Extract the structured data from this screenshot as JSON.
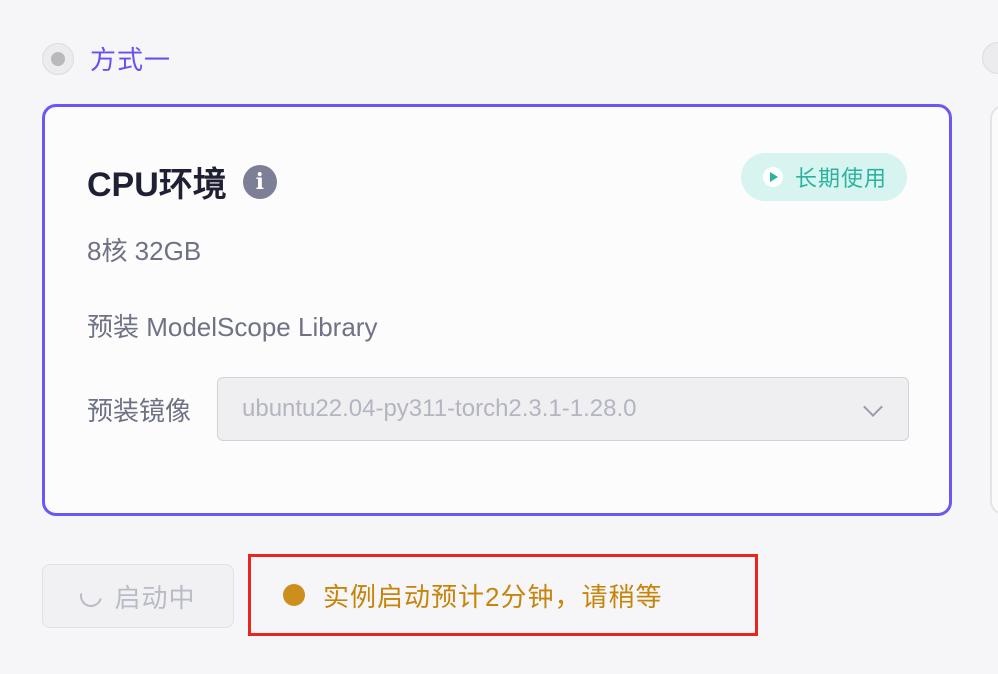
{
  "option": {
    "label": "方式一",
    "selected": true
  },
  "card": {
    "title": "CPU环境",
    "info_icon": "info-icon",
    "badge": {
      "label": "长期使用",
      "icon": "play-icon",
      "color": "#2bb39f"
    },
    "spec": "8核 32GB",
    "library": "预装 ModelScope Library",
    "image": {
      "label": "预装镜像",
      "value": "ubuntu22.04-py311-torch2.3.1-1.28.0",
      "disabled": true
    },
    "accent_color": "#6a57f5"
  },
  "actions": {
    "launch_label": "启动中",
    "launch_state": "loading"
  },
  "notice": {
    "text": "实例启动预计2分钟，请稍等",
    "color": "#c6840a",
    "highlight_color": "#e8261f"
  }
}
